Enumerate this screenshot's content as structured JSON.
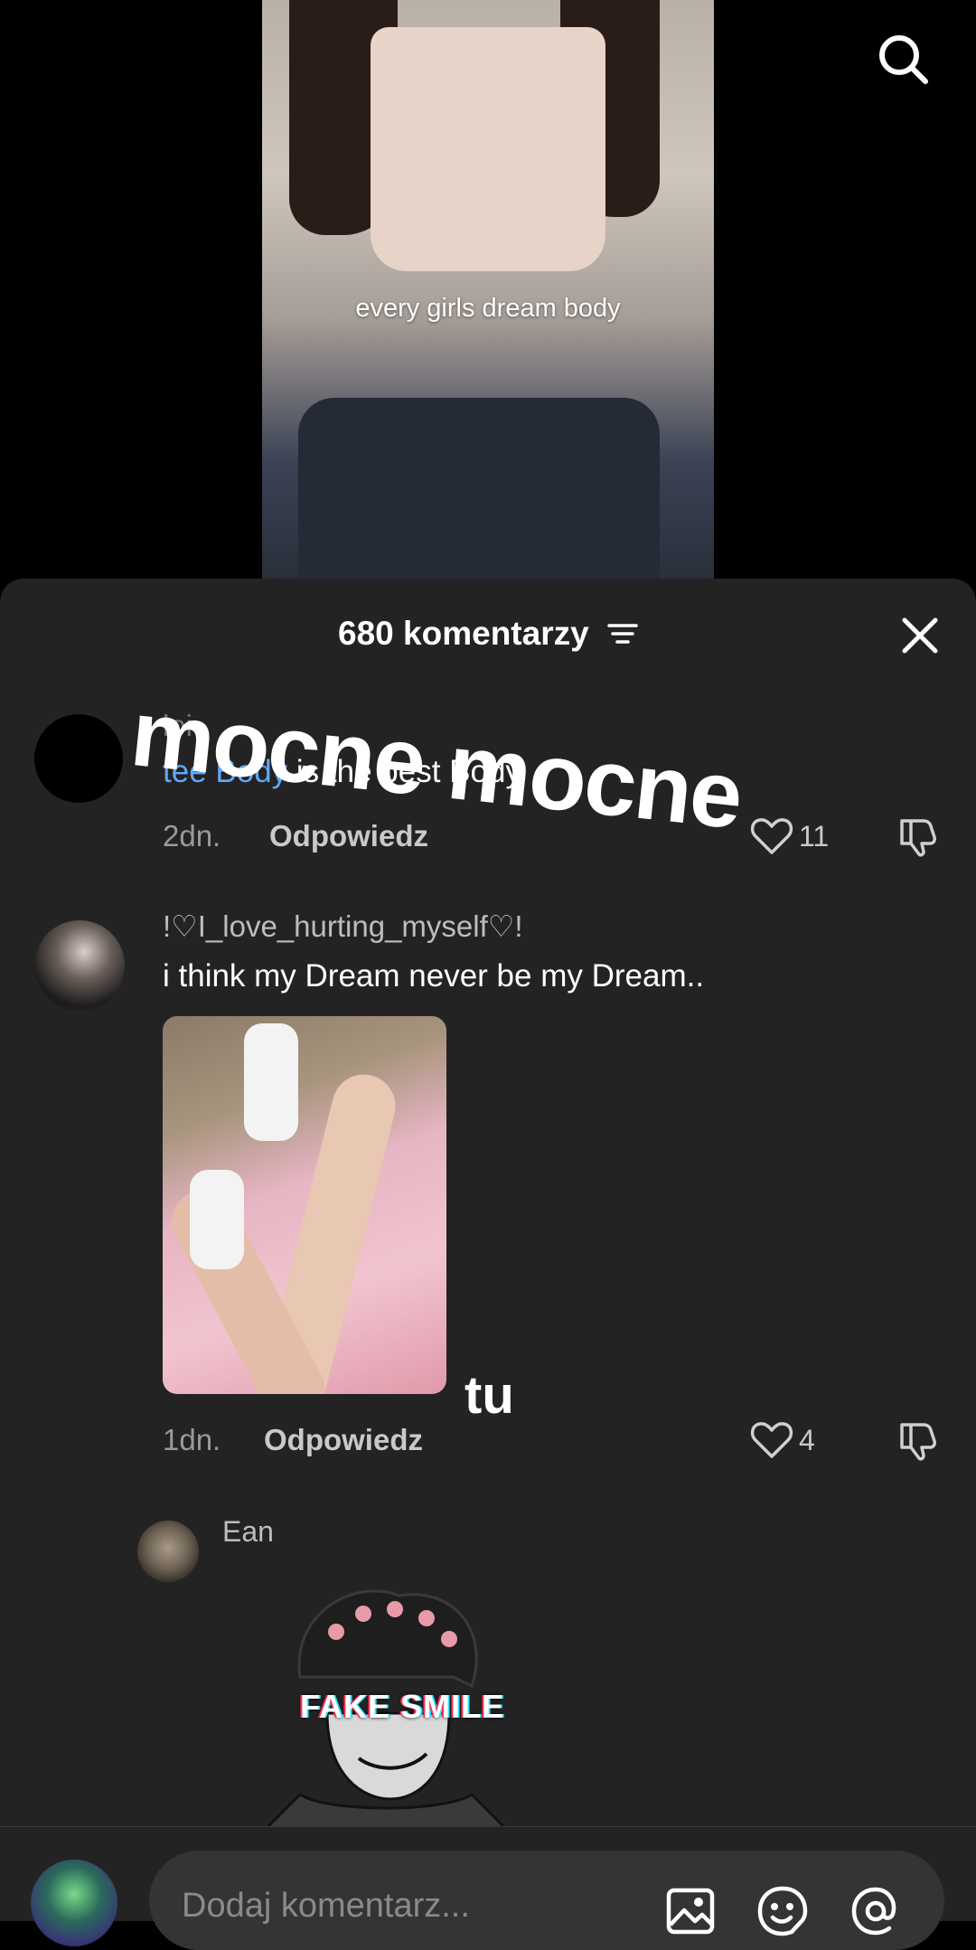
{
  "video": {
    "caption": "every girls dream body"
  },
  "sheet": {
    "title": "680 komentarzy"
  },
  "overlays": {
    "big_text": "mocne mocne",
    "small_text": "tu"
  },
  "comments": [
    {
      "username": "loi",
      "text_mention": "tee Body",
      "text": " is the best Body",
      "time": "2dn.",
      "reply": "Odpowiedz",
      "likes": "11"
    },
    {
      "username": "!♡I_love_hurting_myself♡!",
      "text": "i think my Dream never be my Dream..",
      "time": "1dn.",
      "reply": "Odpowiedz",
      "likes": "4"
    },
    {
      "username": "Ean",
      "sticker_text": "FAKE SMILE"
    }
  ],
  "composer": {
    "placeholder": "Dodaj komentarz..."
  },
  "icons": {
    "search": "search-icon",
    "sort": "sort-icon",
    "close": "close-icon",
    "like": "heart-icon",
    "dislike": "thumbs-down-icon",
    "image": "image-icon",
    "emoji": "emoji-icon",
    "mention": "at-icon"
  },
  "colors": {
    "background": "#000000",
    "sheet": "#232323",
    "mention": "#5fa8ff"
  }
}
